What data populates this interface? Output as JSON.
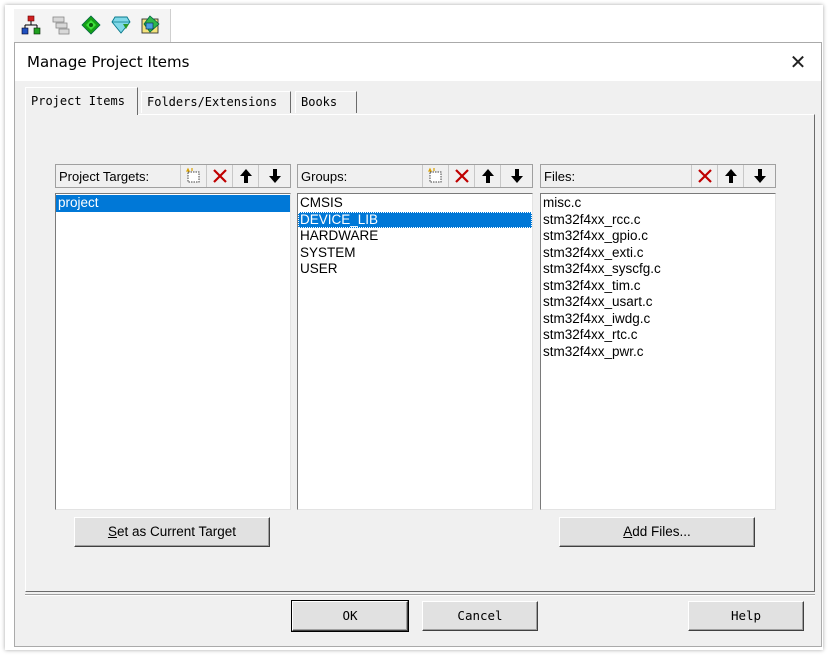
{
  "toolbar": {
    "icons": [
      "project-manage-icon",
      "layers-icon",
      "diamond-green-icon",
      "diamond-download-icon",
      "diamond-picture-icon"
    ]
  },
  "dialog": {
    "title": "Manage Project Items",
    "close_symbol": "✕"
  },
  "tabs": [
    {
      "label": "Project Items",
      "active": true
    },
    {
      "label": "Folders/Extensions",
      "active": false
    },
    {
      "label": "Books",
      "active": false
    }
  ],
  "targets": {
    "label": "Project Targets:",
    "items": [
      "project"
    ],
    "selected_index": 0
  },
  "groups": {
    "label": "Groups:",
    "items": [
      "CMSIS",
      "DEVICE_LIB",
      "HARDWARE",
      "SYSTEM",
      "USER"
    ],
    "selected_index": 1
  },
  "files": {
    "label": "Files:",
    "items": [
      "misc.c",
      "stm32f4xx_rcc.c",
      "stm32f4xx_gpio.c",
      "stm32f4xx_exti.c",
      "stm32f4xx_syscfg.c",
      "stm32f4xx_tim.c",
      "stm32f4xx_usart.c",
      "stm32f4xx_iwdg.c",
      "stm32f4xx_rtc.c",
      "stm32f4xx_pwr.c"
    ]
  },
  "buttons": {
    "set_current_target": {
      "mnemonic": "S",
      "rest": "et as Current Target"
    },
    "add_files": {
      "mnemonic": "A",
      "rest": "dd Files..."
    },
    "ok": "OK",
    "cancel": "Cancel",
    "help": "Help"
  },
  "colors": {
    "selection": "#0078d7",
    "delete_icon": "#c00000",
    "dialog_bg": "#f0f0f0"
  }
}
